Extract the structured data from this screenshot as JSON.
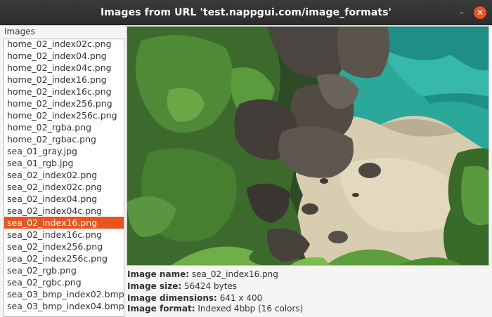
{
  "window": {
    "title": "Images from URL 'test.nappgui.com/image_formats'"
  },
  "list": {
    "label": "Images",
    "items": [
      "home_02_index02c.png",
      "home_02_index04.png",
      "home_02_index04c.png",
      "home_02_index16.png",
      "home_02_index16c.png",
      "home_02_index256.png",
      "home_02_index256c.png",
      "home_02_rgba.png",
      "home_02_rgbac.png",
      "sea_01_gray.jpg",
      "sea_01_rgb.jpg",
      "sea_02_index02.png",
      "sea_02_index02c.png",
      "sea_02_index04.png",
      "sea_02_index04c.png",
      "sea_02_index16.png",
      "sea_02_index16c.png",
      "sea_02_index256.png",
      "sea_02_index256c.png",
      "sea_02_rgb.png",
      "sea_02_rgbc.png",
      "sea_03_bmp_index02.bmp",
      "sea_03_bmp_index04.bmp"
    ],
    "selected": "sea_02_index16.png"
  },
  "info": {
    "name_label": "Image name:",
    "name_value": "sea_02_index16.png",
    "size_label": "Image size:",
    "size_value": "56424 bytes",
    "dims_label": "Image dimensions:",
    "dims_value": "641 x 400",
    "format_label": "Image format:",
    "format_value": "Indexed 4bbp (16 colors)"
  },
  "colors": {
    "accent": "#e95420",
    "titlebar": "#2d2d2d"
  }
}
